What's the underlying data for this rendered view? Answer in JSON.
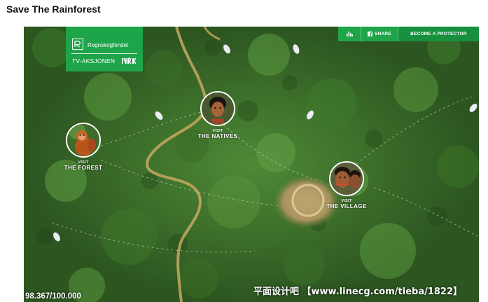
{
  "page": {
    "title": "Save The Rainforest"
  },
  "site": {
    "logo_name": "Regnskogfondet",
    "logo_sub": "TV-AKSJONEN",
    "nrk_logo": "NRK",
    "brand_color": "#1ea54a"
  },
  "topbar": {
    "stats_icon": "bar-chart-icon",
    "share_label": "SHARE",
    "share_icon": "facebook-icon",
    "protector_label": "BECOME A PROTECTOR"
  },
  "destinations": [
    {
      "pre": "VISIT",
      "label": "THE FOREST"
    },
    {
      "pre": "VISIT",
      "label": "THE NATIVES"
    },
    {
      "pre": "VISIT",
      "label": "THE VILLAGE"
    }
  ],
  "counter": {
    "text": "98.367/100.000"
  },
  "watermark": {
    "text": "平面设计吧 【www.linecg.com/tieba/1822】"
  }
}
